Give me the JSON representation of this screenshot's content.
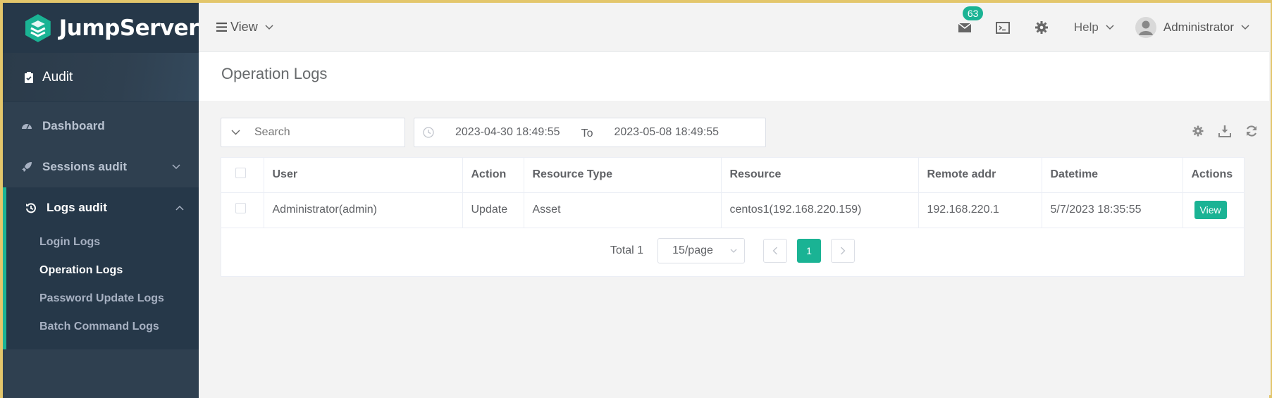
{
  "brand": "JumpServer",
  "section": "Audit",
  "sidebar": {
    "items": [
      {
        "label": "Dashboard"
      },
      {
        "label": "Sessions audit"
      },
      {
        "label": "Logs audit"
      }
    ],
    "submenu": [
      {
        "label": "Login Logs"
      },
      {
        "label": "Operation Logs"
      },
      {
        "label": "Password Update Logs"
      },
      {
        "label": "Batch Command Logs"
      }
    ]
  },
  "topnav": {
    "view_label": "View",
    "badge_count": "63",
    "help_label": "Help",
    "user_label": "Administrator"
  },
  "page": {
    "title": "Operation Logs"
  },
  "filters": {
    "search_placeholder": "Search",
    "date_from": "2023-04-30 18:49:55",
    "date_sep": "To",
    "date_to": "2023-05-08 18:49:55"
  },
  "table": {
    "headers": [
      "User",
      "Action",
      "Resource Type",
      "Resource",
      "Remote addr",
      "Datetime",
      "Actions"
    ],
    "rows": [
      {
        "user": "Administrator(admin)",
        "action": "Update",
        "resource_type": "Asset",
        "resource": "centos1(192.168.220.159)",
        "remote_addr": "192.168.220.1",
        "datetime": "5/7/2023 18:35:55",
        "action_btn": "View"
      }
    ]
  },
  "pager": {
    "total": "Total 1",
    "page_size": "15/page",
    "current_page": "1"
  },
  "colors": {
    "accent": "#1ab394",
    "sidebar": "#2f4050"
  }
}
